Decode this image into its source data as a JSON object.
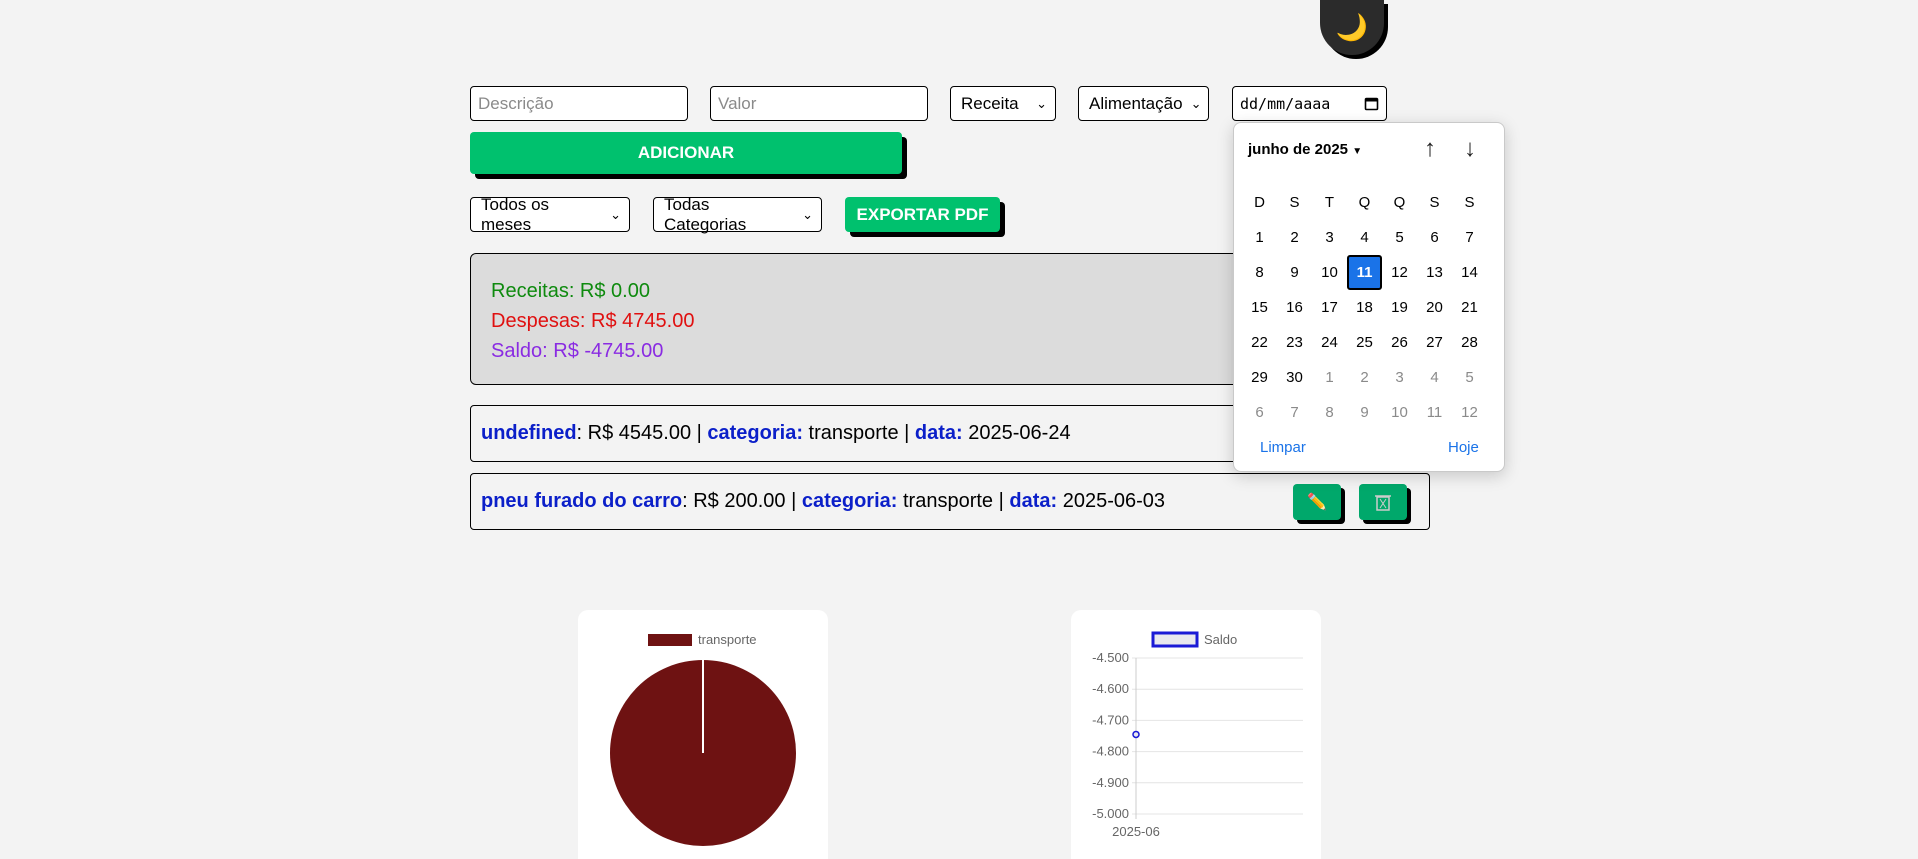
{
  "theme_toggle": {
    "icon": "🌙"
  },
  "form": {
    "descricao_placeholder": "Descrição",
    "valor_placeholder": "Valor",
    "tipo_selected": "Receita",
    "categoria_selected": "Alimentação",
    "date_placeholder": "dd/mm/aaaa",
    "add_label": "ADICIONAR"
  },
  "filters": {
    "month_selected": "Todos os meses",
    "category_selected": "Todas Categorias",
    "export_label": "EXPORTAR PDF"
  },
  "summary": {
    "receitas": "Receitas: R$ 0.00",
    "despesas": "Despesas: R$ 4745.00",
    "saldo": "Saldo: R$ -4745.00"
  },
  "transactions": [
    {
      "desc": "undefined",
      "valor": ": R$ 4545.00 | ",
      "cat_label": "categoria:",
      "cat": " transporte | ",
      "data_label": "data:",
      "data": " 2025-06-24"
    },
    {
      "desc": "pneu furado do carro",
      "valor": ": R$ 200.00 | ",
      "cat_label": "categoria:",
      "cat": " transporte | ",
      "data_label": "data:",
      "data": " 2025-06-03"
    }
  ],
  "calendar": {
    "month_label": "junho de 2025",
    "weekdays": [
      "D",
      "S",
      "T",
      "Q",
      "Q",
      "S",
      "S"
    ],
    "days": [
      "1",
      "2",
      "3",
      "4",
      "5",
      "6",
      "7",
      "8",
      "9",
      "10",
      "11",
      "12",
      "13",
      "14",
      "15",
      "16",
      "17",
      "18",
      "19",
      "20",
      "21",
      "22",
      "23",
      "24",
      "25",
      "26",
      "27",
      "28",
      "29",
      "30",
      "1",
      "2",
      "3",
      "4",
      "5",
      "6",
      "7",
      "8",
      "9",
      "10",
      "11",
      "12"
    ],
    "selected_day": "11",
    "clear_label": "Limpar",
    "today_label": "Hoje"
  },
  "chart_data": [
    {
      "type": "pie",
      "legend": [
        "transporte"
      ],
      "categories": [
        "transporte"
      ],
      "values": [
        4745
      ],
      "colors": [
        "#6e1212"
      ]
    },
    {
      "type": "line",
      "legend": [
        "Saldo"
      ],
      "x": [
        "2025-06"
      ],
      "series": [
        {
          "name": "Saldo",
          "values": [
            -4745
          ]
        }
      ],
      "ylim": [
        -5000,
        -4500
      ],
      "yticks": [
        "-4.500",
        "-4.600",
        "-4.700",
        "-4.800",
        "-4.900",
        "-5.000"
      ],
      "grid": true
    }
  ]
}
